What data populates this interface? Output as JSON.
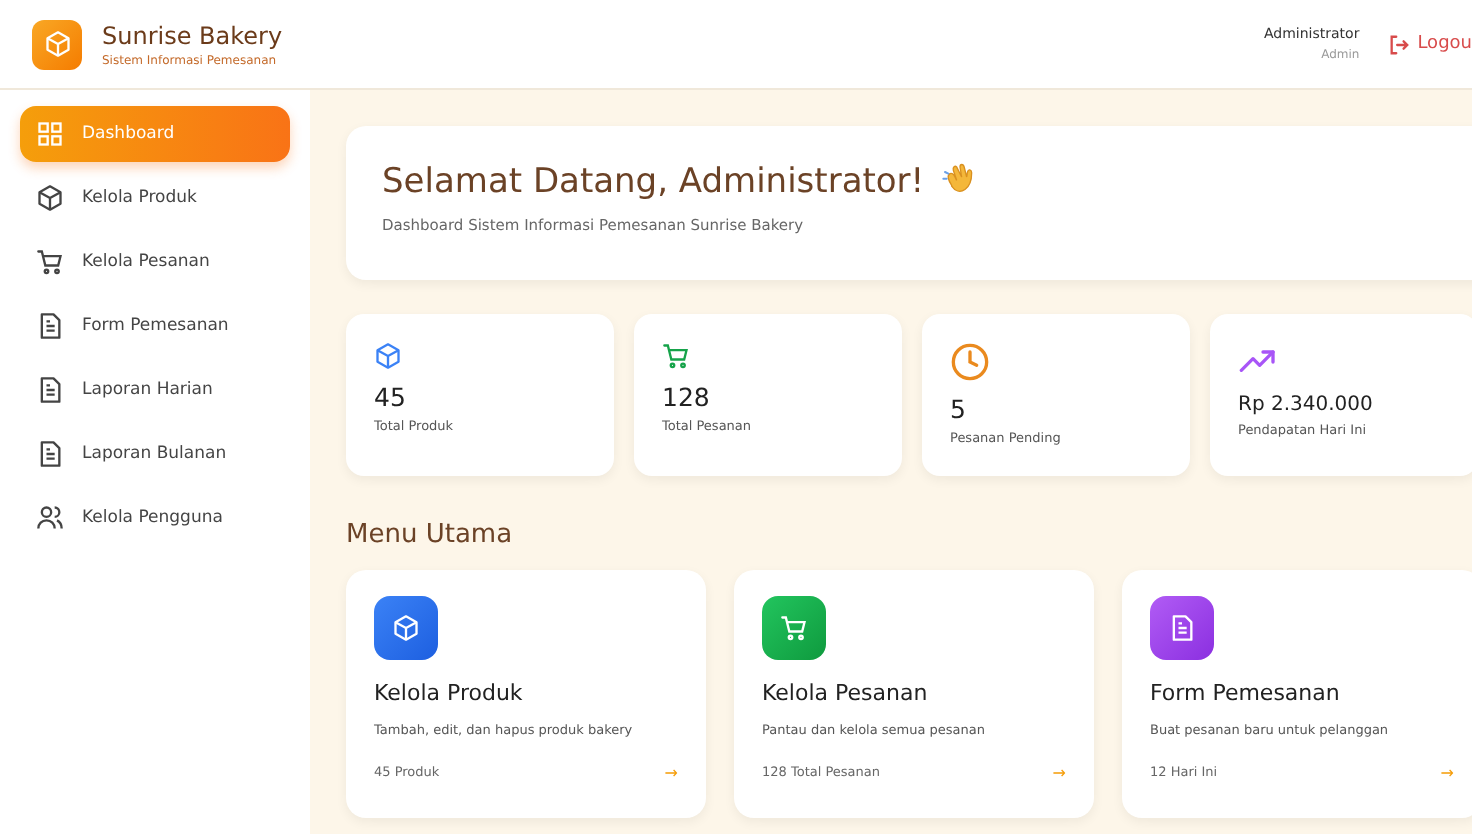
{
  "brand": {
    "name": "Sunrise Bakery",
    "subtitle": "Sistem Informasi Pemesanan"
  },
  "user": {
    "name": "Administrator",
    "role": "Admin",
    "logout": "Logou"
  },
  "sidebar": {
    "items": [
      {
        "label": "Dashboard",
        "selected": true
      },
      {
        "label": "Kelola Produk",
        "selected": false
      },
      {
        "label": "Kelola Pesanan",
        "selected": false
      },
      {
        "label": "Form Pemesanan",
        "selected": false
      },
      {
        "label": "Laporan Harian",
        "selected": false
      },
      {
        "label": "Laporan Bulanan",
        "selected": false
      },
      {
        "label": "Kelola Pengguna",
        "selected": false
      }
    ]
  },
  "welcome": {
    "title": "Selamat Datang, Administrator!",
    "subtitle": "Dashboard Sistem Informasi Pemesanan Sunrise Bakery"
  },
  "stats": [
    {
      "value": "45",
      "label": "Total Produk"
    },
    {
      "value": "128",
      "label": "Total Pesanan"
    },
    {
      "value": "5",
      "label": "Pesanan Pending"
    },
    {
      "value": "Rp 2.340.000",
      "label": "Pendapatan Hari Ini"
    }
  ],
  "menu": {
    "title": "Menu Utama",
    "cards": [
      {
        "title": "Kelola Produk",
        "description": "Tambah, edit, dan hapus produk bakery",
        "footer": "45 Produk",
        "arrow": "→"
      },
      {
        "title": "Kelola Pesanan",
        "description": "Pantau dan kelola semua pesanan",
        "footer": "128 Total Pesanan",
        "arrow": "→"
      },
      {
        "title": "Form Pemesanan",
        "description": "Buat pesanan baru untuk pelanggan",
        "footer": "12 Hari Ini",
        "arrow": "→"
      }
    ]
  }
}
